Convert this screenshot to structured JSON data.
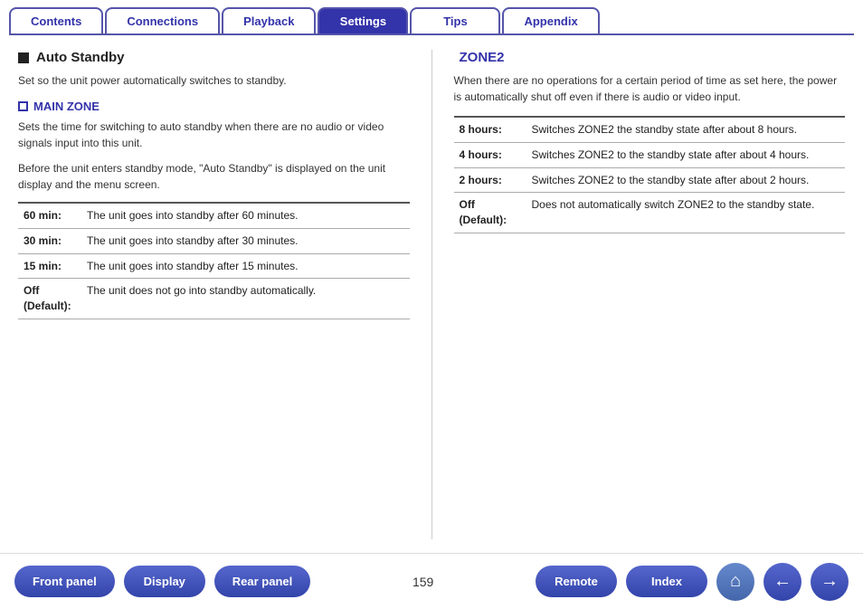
{
  "tabs": [
    {
      "id": "contents",
      "label": "Contents",
      "active": false
    },
    {
      "id": "connections",
      "label": "Connections",
      "active": false
    },
    {
      "id": "playback",
      "label": "Playback",
      "active": false
    },
    {
      "id": "settings",
      "label": "Settings",
      "active": true
    },
    {
      "id": "tips",
      "label": "Tips",
      "active": false
    },
    {
      "id": "appendix",
      "label": "Appendix",
      "active": false
    }
  ],
  "left": {
    "section_title": "Auto Standby",
    "section_desc": "Set so the unit power automatically switches to standby.",
    "sub_title": "MAIN ZONE",
    "sub_desc1": "Sets the time for switching to auto standby when there are no audio or video signals input into this unit.",
    "sub_desc2": "Before the unit enters standby mode, \"Auto Standby\" is displayed on the unit display and the menu screen.",
    "table_rows": [
      {
        "key": "60 min:",
        "value": "The unit goes into standby after 60 minutes."
      },
      {
        "key": "30 min:",
        "value": "The unit goes into standby after 30 minutes."
      },
      {
        "key": "15 min:",
        "value": "The unit goes into standby after 15 minutes."
      },
      {
        "key": "Off\n(Default):",
        "value": "The unit does not go into standby automatically."
      }
    ]
  },
  "right": {
    "section_title": "ZONE2",
    "section_intro": "When there are no operations for a certain period of time as set here, the power is automatically shut off even if there is audio or video input.",
    "table_rows": [
      {
        "key": "8 hours:",
        "value": "Switches ZONE2 the standby state after about 8 hours."
      },
      {
        "key": "4 hours:",
        "value": "Switches ZONE2 to the standby state after about 4 hours."
      },
      {
        "key": "2 hours:",
        "value": "Switches ZONE2 to the standby state after about 2 hours."
      },
      {
        "key": "Off\n(Default):",
        "value": "Does not automatically switch ZONE2 to the standby state."
      }
    ]
  },
  "bottom": {
    "page_number": "159",
    "front_panel_label": "Front panel",
    "display_label": "Display",
    "rear_panel_label": "Rear panel",
    "remote_label": "Remote",
    "index_label": "Index",
    "home_icon": "⌂",
    "back_icon": "←",
    "forward_icon": "→"
  }
}
